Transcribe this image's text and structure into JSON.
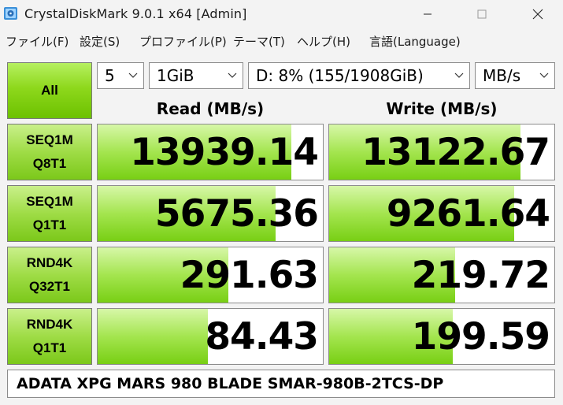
{
  "window": {
    "title": "CrystalDiskMark 9.0.1 x64 [Admin]",
    "icons": {
      "app": "crystaldiskmark-app-icon",
      "minimize": "minimize-icon",
      "maximize": "maximize-icon",
      "close": "close-icon"
    }
  },
  "menu": {
    "file": "ファイル(F)",
    "settings": "設定(S)",
    "profile": "プロファイル(P)",
    "theme": "テーマ(T)",
    "help": "ヘルプ(H)",
    "language": "言語(Language)"
  },
  "controls": {
    "all_label": "All",
    "count": "5",
    "size": "1GiB",
    "drive": "D: 8% (155/1908GiB)",
    "unit": "MB/s"
  },
  "headers": {
    "read": "Read (MB/s)",
    "write": "Write (MB/s)"
  },
  "tests": [
    {
      "line1": "SEQ1M",
      "line2": "Q8T1",
      "read": "13939.14",
      "write": "13122.67",
      "read_fill": 0.86,
      "write_fill": 0.85
    },
    {
      "line1": "SEQ1M",
      "line2": "Q1T1",
      "read": "5675.36",
      "write": "9261.64",
      "read_fill": 0.79,
      "write_fill": 0.82
    },
    {
      "line1": "RND4K",
      "line2": "Q32T1",
      "read": "291.63",
      "write": "219.72",
      "read_fill": 0.58,
      "write_fill": 0.56
    },
    {
      "line1": "RND4K",
      "line2": "Q1T1",
      "read": "84.43",
      "write": "199.59",
      "read_fill": 0.49,
      "write_fill": 0.55
    }
  ],
  "comment": "ADATA XPG MARS 980 BLADE SMAR-980B-2TCS-DP",
  "colors": {
    "accent_green": "#8ed81c",
    "bar_green": "#a4e54f",
    "background": "#f3f3f3"
  }
}
